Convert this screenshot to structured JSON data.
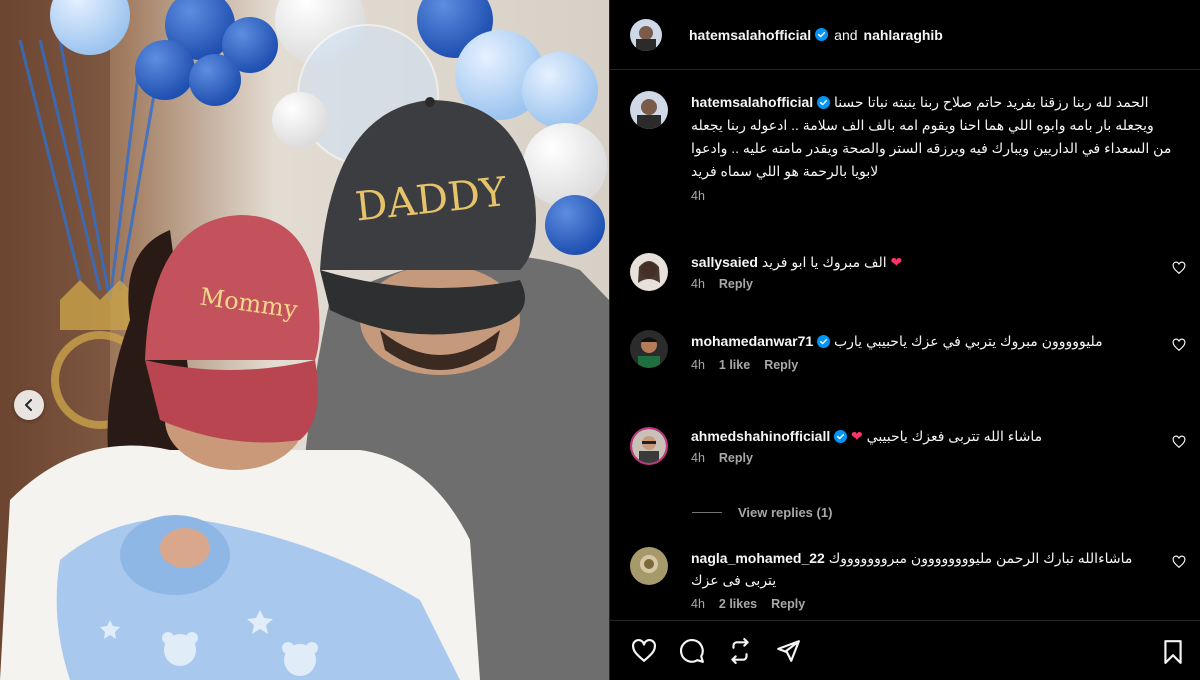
{
  "post": {
    "author": "hatemsalahofficial",
    "conjunction": "and",
    "coauthor": "nahlaraghib"
  },
  "caption": {
    "username": "hatemsalahofficial",
    "text": "الحمد لله ربنا رزقنا بفريد حاتم صلاح ربنا ينبته نباتا حسنا ويجعله بار بامه وابوه اللي هما احنا ويقوم امه بالف الف سلامة .. ادعوله ربنا يجعله من السعداء في الداريين ويبارك فيه ويرزقه الستر والصحة ويقدر مامته عليه .. وادعوا لابويا بالرحمة هو اللي سماه فريد",
    "time": "4h"
  },
  "comments": [
    {
      "username": "sallysaied",
      "verified": false,
      "text": "الف مبروك يا ابو فريد",
      "emoji": "❤",
      "time": "4h",
      "likes": "",
      "reply": "Reply"
    },
    {
      "username": "mohamedanwar71",
      "verified": true,
      "text": "مليووووون مبروك يتربي في عزك ياحبيبي يارب",
      "emoji": "",
      "time": "4h",
      "likes": "1 like",
      "reply": "Reply"
    },
    {
      "username": "ahmedshahinofficiall",
      "verified": true,
      "text": "ماشاء الله تتربى فعزك ياحبيبي",
      "emoji": "❤",
      "time": "4h",
      "likes": "",
      "reply": "Reply"
    },
    {
      "username": "nagla_mohamed_22",
      "verified": false,
      "text": "ماشاءالله تبارك الرحمن مليوووووووون مبروووووووك يتربى فى عزك",
      "emoji": "",
      "time": "4h",
      "likes": "2 likes",
      "reply": "Reply"
    }
  ],
  "view_replies": "View replies (1)",
  "photo": {
    "cap_left_text": "Mommy",
    "cap_right_text": "DADDY"
  },
  "colors": {
    "verified": "#0095f6",
    "heart_emoji": "#ff3366",
    "muted": "#a8a8a8"
  },
  "icons": [
    "heart-icon",
    "comment-icon",
    "share-icon",
    "send-icon",
    "bookmark-icon",
    "chevron-left-icon",
    "verified-icon"
  ]
}
